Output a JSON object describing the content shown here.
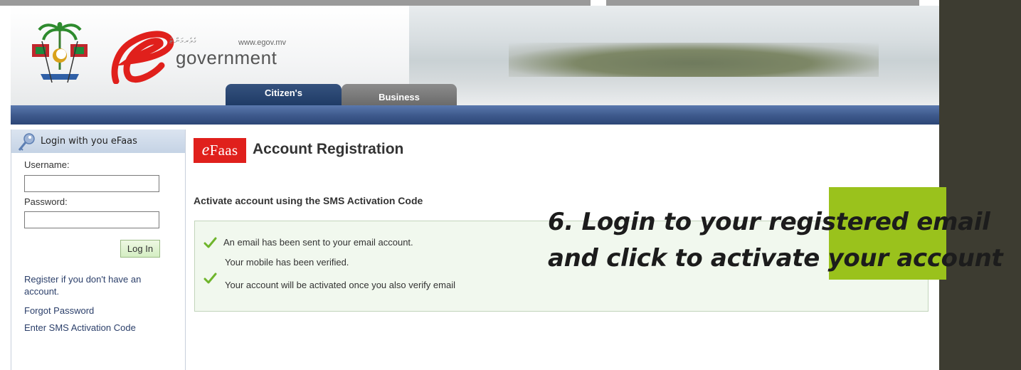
{
  "header": {
    "dhivehi_text": "ގެވެރމަންޓް",
    "website": "www.egov.mv",
    "logo_word": "government",
    "tabs": [
      {
        "label": "Citizen's",
        "active": true
      },
      {
        "label": "Business",
        "active": false
      }
    ]
  },
  "sidebar": {
    "title": "Login with you eFaas",
    "username_label": "Username:",
    "username_value": "",
    "password_label": "Password:",
    "password_value": "",
    "login_button": "Log In",
    "links": [
      "Register if you don't have an account.",
      "Forgot Password",
      "Enter SMS Activation Code"
    ]
  },
  "main": {
    "logo_e": "e",
    "logo_text": "Faas",
    "title": "Account Registration",
    "subtitle": "Activate account using the SMS Activation Code",
    "messages": [
      "An email has been sent to your email account.",
      "Your mobile has been verified.",
      "Your account will be activated once you also verify email"
    ]
  },
  "callout": {
    "line1": "6. Login to your registered email",
    "line2": "and click to activate your account"
  },
  "colors": {
    "nav_blue": "#3f5b8e",
    "tab_active": "#1f3b66",
    "tab_inactive": "#6b6b6b",
    "efaas_red": "#e0201c",
    "callout_green": "#9ac21c",
    "message_bg": "#f1f8ee",
    "outer_bg": "#3d3c31"
  }
}
